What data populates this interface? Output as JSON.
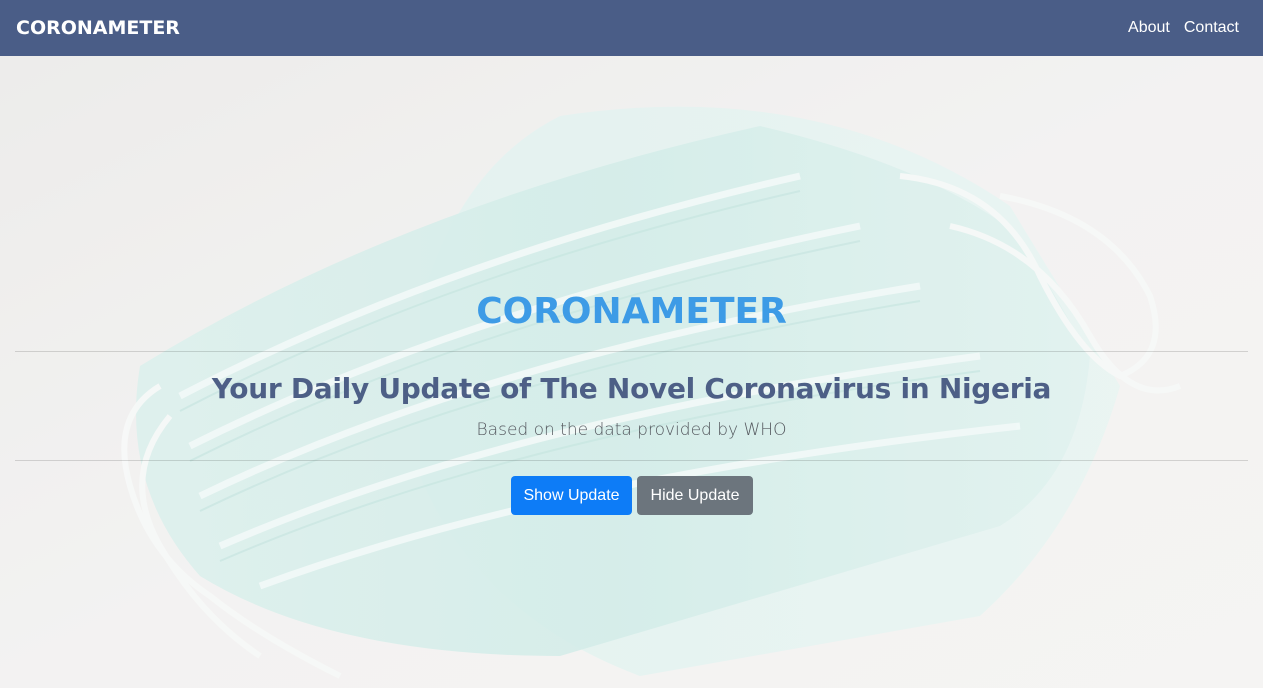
{
  "navbar": {
    "brand": "CORONAMETER",
    "links": [
      {
        "label": "About"
      },
      {
        "label": "Contact"
      }
    ],
    "background_color": "#4a5d87"
  },
  "hero": {
    "background_image": "face-mask-photo",
    "title": "CORONAMETER",
    "subtitle": "Your Daily Update of The Novel Coronavirus in Nigeria",
    "lead": "Based on the data provided by WHO",
    "buttons": {
      "show_label": "Show Update",
      "hide_label": "Hide Update"
    },
    "title_color": "#3d9be6",
    "subtitle_color": "#4d5f86",
    "primary_color": "#0d7cf7",
    "secondary_color": "#6c757d"
  }
}
